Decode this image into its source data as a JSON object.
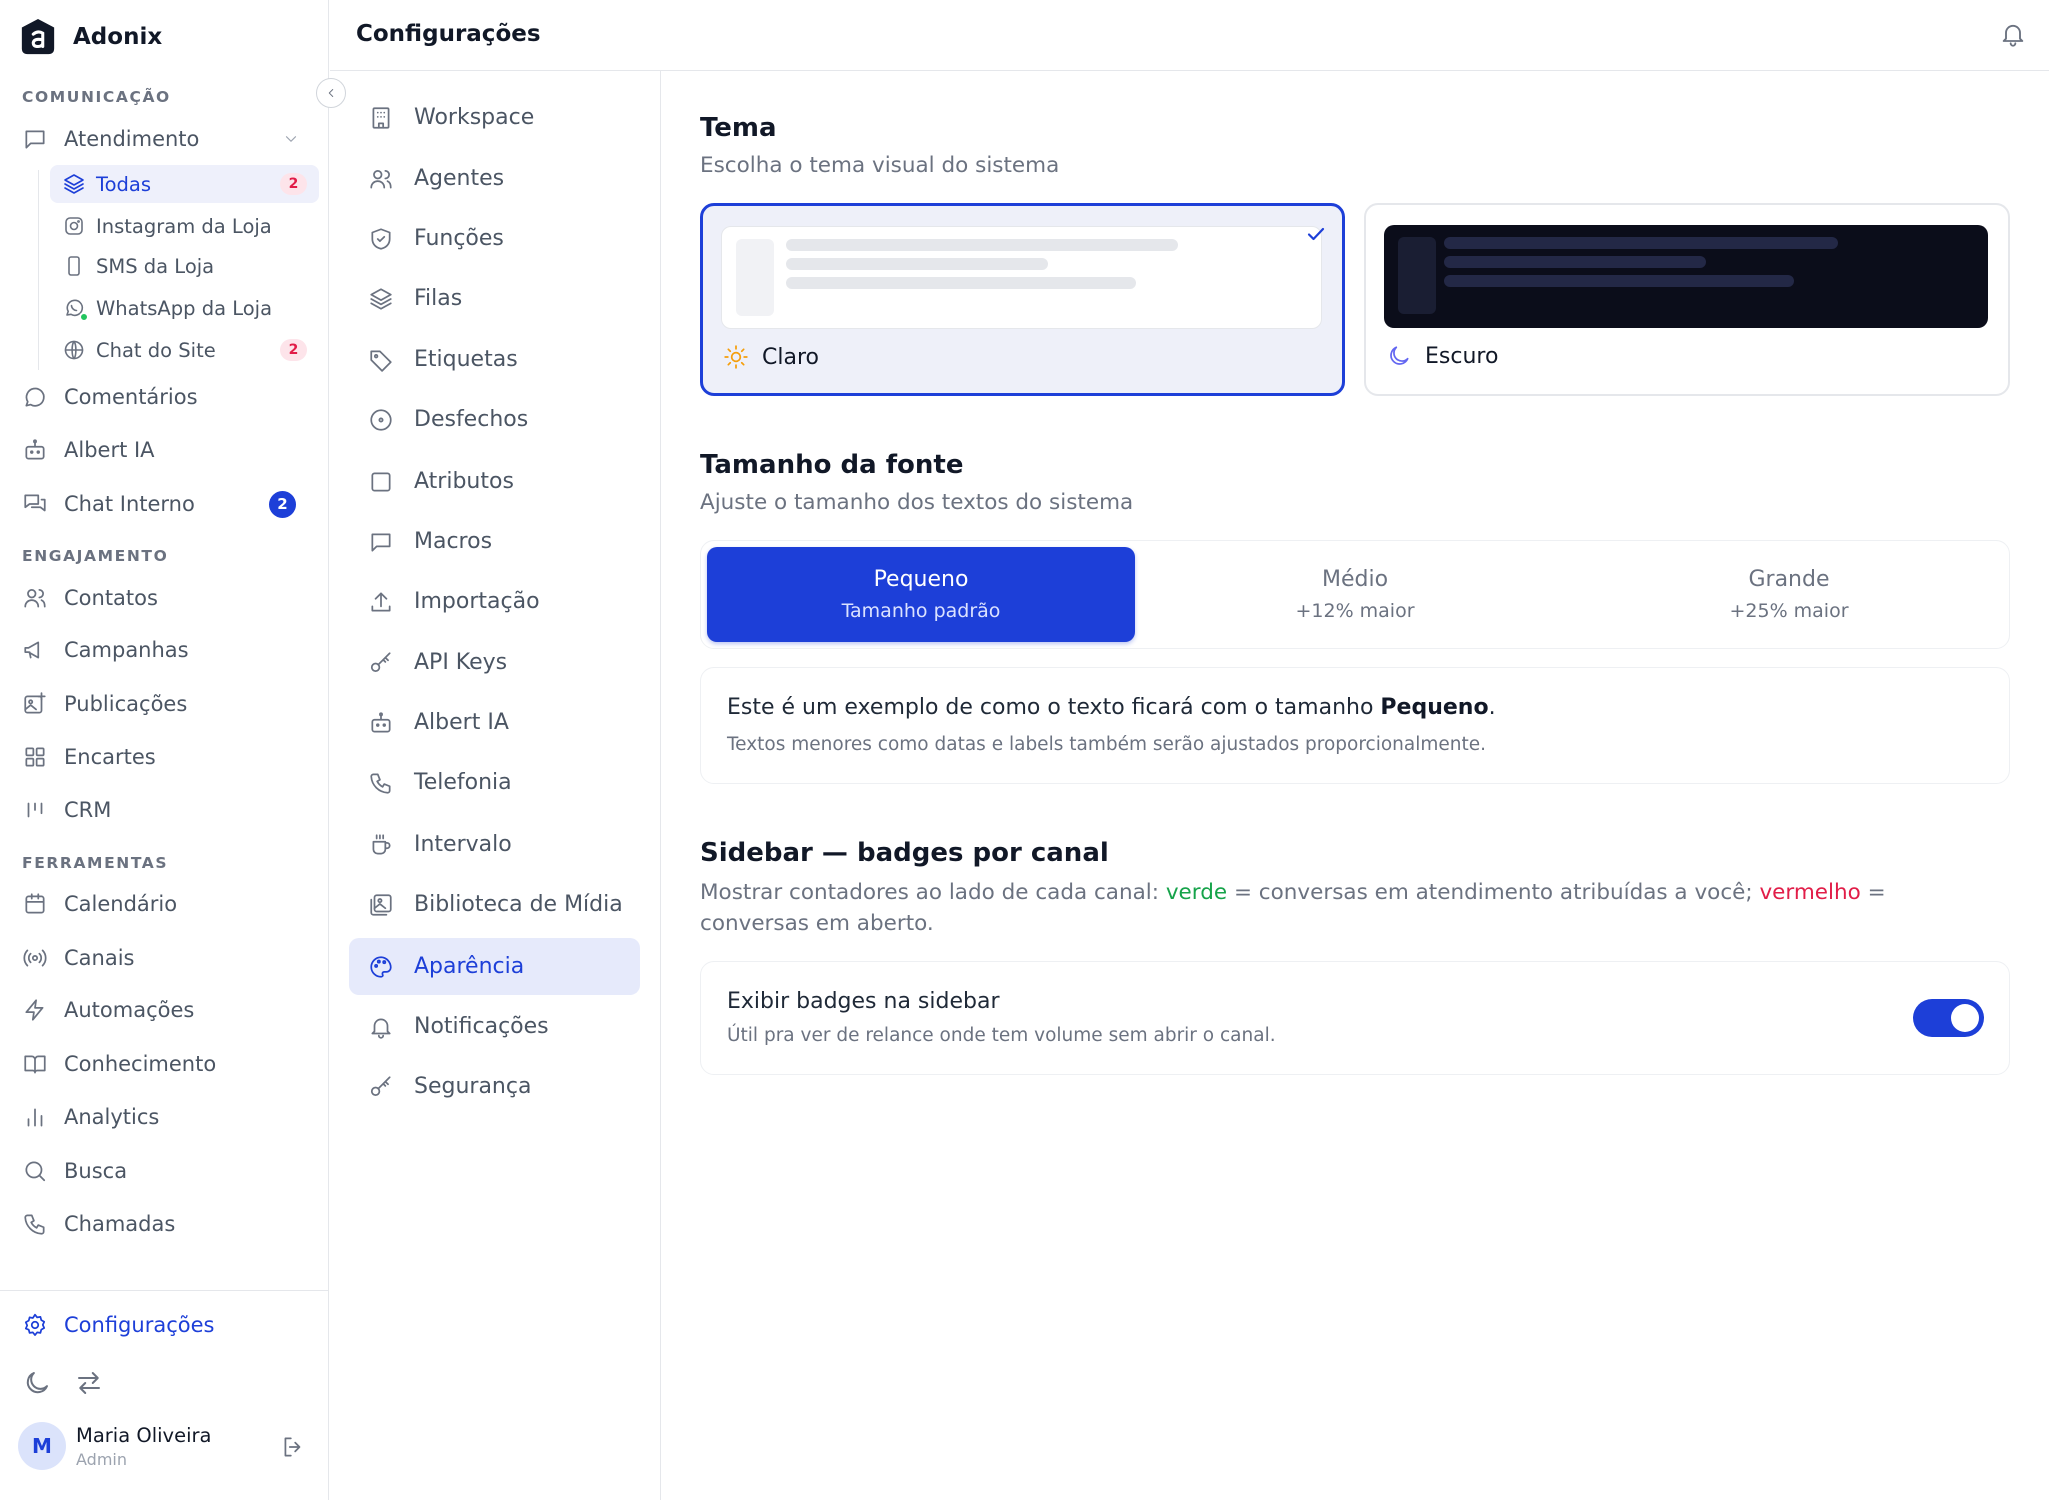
{
  "app": {
    "name": "Adonix"
  },
  "sidebar": {
    "sections": {
      "comunicacao": "COMUNICAÇÃO",
      "engajamento": "ENGAJAMENTO",
      "ferramentas": "FERRAMENTAS"
    },
    "atendimento": {
      "label": "Atendimento",
      "channels": [
        {
          "label": "Todas",
          "badge": "2",
          "icon": "layers-icon",
          "active": true
        },
        {
          "label": "Instagram da Loja",
          "icon": "instagram-icon"
        },
        {
          "label": "SMS da Loja",
          "icon": "phone-device-icon"
        },
        {
          "label": "WhatsApp da Loja",
          "icon": "whatsapp-icon"
        },
        {
          "label": "Chat do Site",
          "badge": "2",
          "icon": "globe-icon"
        }
      ]
    },
    "items": {
      "comentarios": "Comentários",
      "albert": "Albert IA",
      "chat_interno": "Chat Interno",
      "chat_interno_badge": "2",
      "contatos": "Contatos",
      "campanhas": "Campanhas",
      "publicacoes": "Publicações",
      "encartes": "Encartes",
      "crm": "CRM",
      "calendario": "Calendário",
      "canais": "Canais",
      "automacoes": "Automações",
      "conhecimento": "Conhecimento",
      "analytics": "Analytics",
      "busca": "Busca",
      "chamadas": "Chamadas"
    },
    "settings_label": "Configurações",
    "user": {
      "initial": "M",
      "name": "Maria Oliveira",
      "role": "Admin"
    }
  },
  "topbar": {
    "title": "Configurações"
  },
  "settings_nav": [
    {
      "label": "Workspace",
      "icon": "building-icon"
    },
    {
      "label": "Agentes",
      "icon": "users-icon"
    },
    {
      "label": "Funções",
      "icon": "shield-icon"
    },
    {
      "label": "Filas",
      "icon": "layers-icon"
    },
    {
      "label": "Etiquetas",
      "icon": "tag-icon"
    },
    {
      "label": "Desfechos",
      "icon": "circle-dot-icon"
    },
    {
      "label": "Atributos",
      "icon": "square-icon"
    },
    {
      "label": "Macros",
      "icon": "message-square-icon"
    },
    {
      "label": "Importação",
      "icon": "upload-icon"
    },
    {
      "label": "API Keys",
      "icon": "key-icon"
    },
    {
      "label": "Albert IA",
      "icon": "bot-icon"
    },
    {
      "label": "Telefonia",
      "icon": "phone-icon"
    },
    {
      "label": "Intervalo",
      "icon": "coffee-icon"
    },
    {
      "label": "Biblioteca de Mídia",
      "icon": "image-library-icon"
    },
    {
      "label": "Aparência",
      "icon": "palette-icon",
      "active": true
    },
    {
      "label": "Notificações",
      "icon": "bell-icon"
    },
    {
      "label": "Segurança",
      "icon": "key-icon"
    }
  ],
  "appearance": {
    "theme": {
      "title": "Tema",
      "description": "Escolha o tema visual do sistema",
      "options": [
        {
          "label": "Claro",
          "selected": true,
          "icon": "sun-icon"
        },
        {
          "label": "Escuro",
          "selected": false,
          "icon": "moon-icon"
        }
      ]
    },
    "font_size": {
      "title": "Tamanho da fonte",
      "description": "Ajuste o tamanho dos textos do sistema",
      "options": [
        {
          "label": "Pequeno",
          "sub": "Tamanho padrão",
          "selected": true
        },
        {
          "label": "Médio",
          "sub": "+12% maior"
        },
        {
          "label": "Grande",
          "sub": "+25% maior"
        }
      ],
      "example_prefix": "Este é um exemplo de como o texto ficará com o tamanho ",
      "example_bold": "Pequeno",
      "example_suffix": ".",
      "example_sub": "Textos menores como datas e labels também serão ajustados proporcionalmente."
    },
    "badges": {
      "title": "Sidebar — badges por canal",
      "desc_1": "Mostrar contadores ao lado de cada canal: ",
      "desc_green": "verde",
      "desc_2": " = conversas em atendimento atribuídas a você; ",
      "desc_red": "vermelho",
      "desc_3": " = conversas em aberto.",
      "toggle_label": "Exibir badges na sidebar",
      "toggle_sub": "Útil pra ver de relance onde tem volume sem abrir o canal.",
      "enabled": true
    }
  },
  "colors": {
    "accent": "#1d3fd8",
    "green": "#16a34a",
    "red": "#e11d48"
  }
}
